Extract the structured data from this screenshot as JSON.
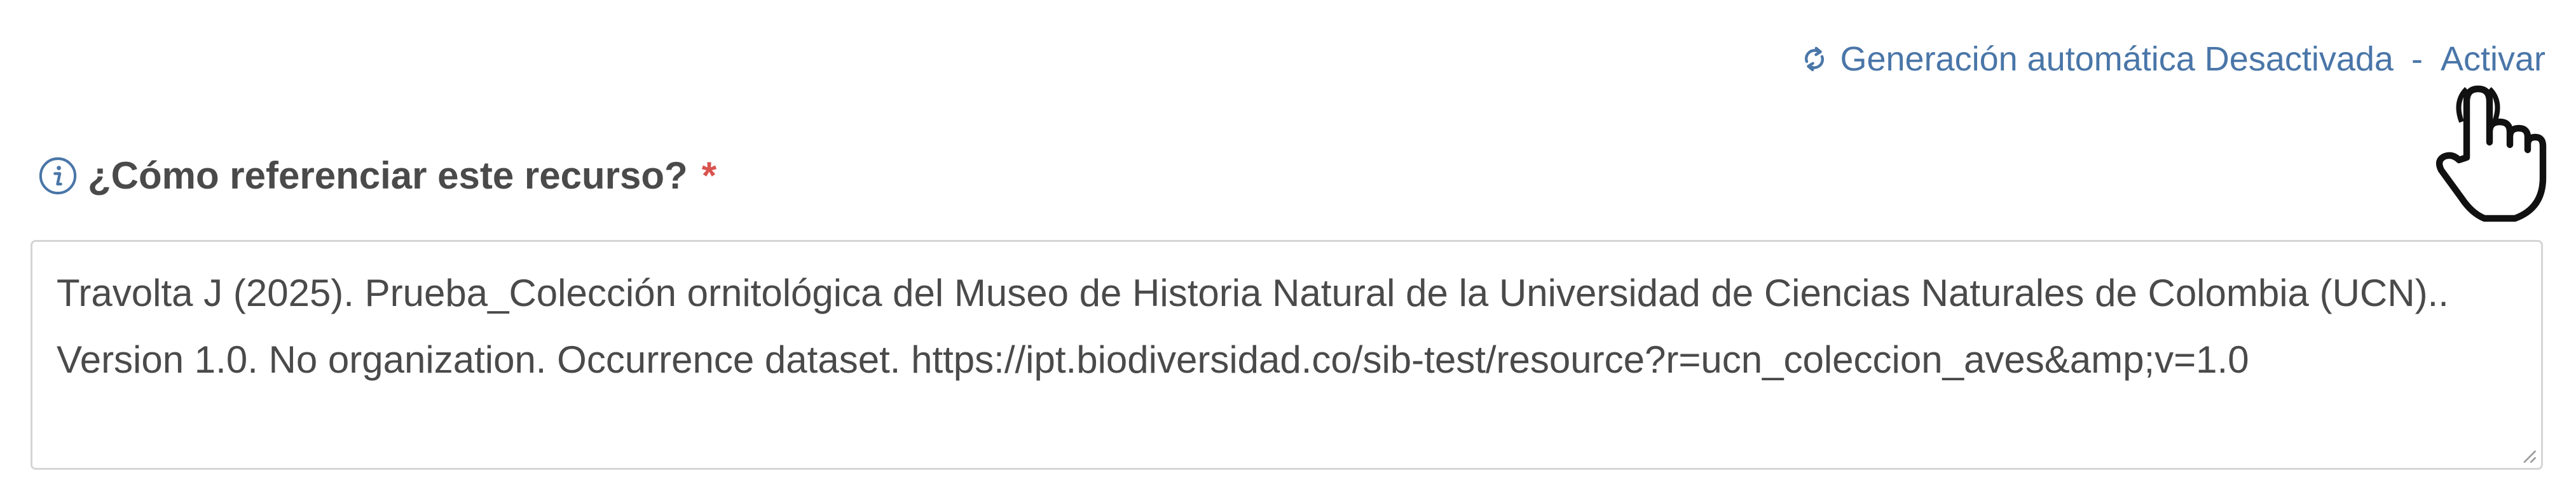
{
  "auto_generation": {
    "icon": "refresh-icon",
    "status_text": "Generación automática Desactivada",
    "separator": "-",
    "action_label": "Activar",
    "color": "#4a76a8"
  },
  "citation_field": {
    "info_icon": "info-icon",
    "label": "¿Cómo referenciar este recurso?",
    "required_marker": "*",
    "required_color": "#d9534f",
    "value": "Travolta J (2025). Prueba_Colección ornitológica del Museo de Historia Natural de la Universidad de Ciencias Naturales de Colombia (UCN).. Version 1.0. No organization. Occurrence dataset. https://ipt.biodiversidad.co/sib-test/resource?r=ucn_coleccion_aves&amp;v=1.0"
  },
  "cursor": {
    "icon": "hand-pointer-cursor-icon"
  }
}
